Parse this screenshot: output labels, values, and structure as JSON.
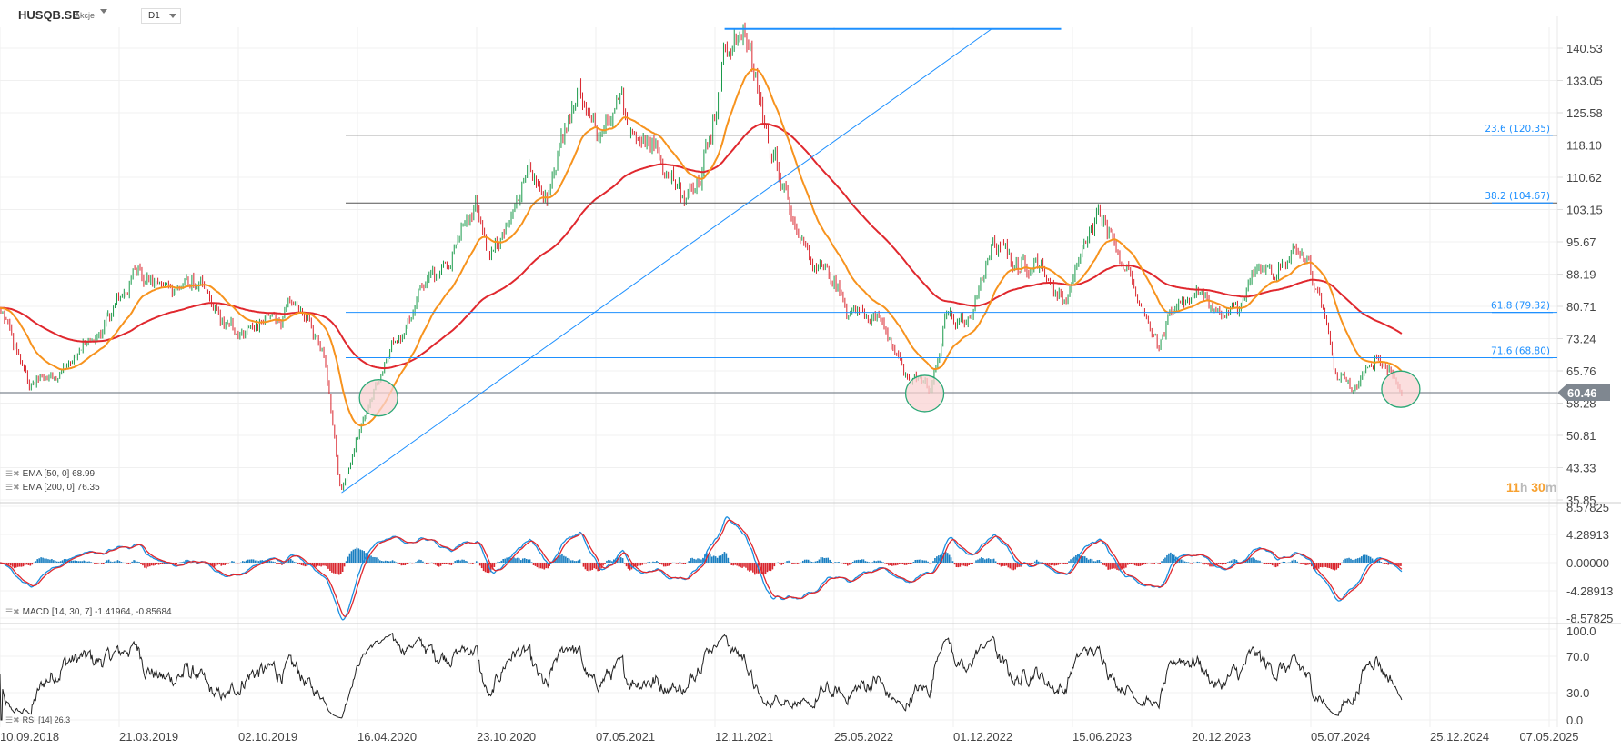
{
  "header": {
    "symbol": "HUSQB.SE",
    "type": "Akcje",
    "timeframe": "D1"
  },
  "legends": {
    "ema50": "EMA [50, 0] 68.99",
    "ema200": "EMA [200, 0] 76.35",
    "macd": "MACD [14, 30, 7] -1.41964, -0.85684",
    "rsi": "RSI [14] 26.3"
  },
  "timer": {
    "hours": "11",
    "h": "h",
    "minutes": "30",
    "m": "m"
  },
  "colors": {
    "up": "#1a9a4a",
    "down": "#d9262e",
    "ema50": "#f7931e",
    "ema200": "#e0282e",
    "fib": "#1e90ff",
    "macd_pos": "#1a7fc1",
    "macd_neg": "#d9262e",
    "circle_fill": "#f9d3d3",
    "circle_stroke": "#2aa876"
  },
  "chart_data": {
    "type": "candlestick",
    "title": "HUSQB.SE D1",
    "x_unit": "calendar days since 10.09.2018",
    "keypoints": [
      [
        0,
        80
      ],
      [
        49,
        62
      ],
      [
        114,
        68
      ],
      [
        162,
        75
      ],
      [
        219,
        90
      ],
      [
        260,
        85
      ],
      [
        309,
        86
      ],
      [
        357,
        75
      ],
      [
        422,
        77
      ],
      [
        471,
        80
      ],
      [
        512,
        70
      ],
      [
        536,
        38
      ],
      [
        560,
        50
      ],
      [
        585,
        60
      ],
      [
        617,
        70
      ],
      [
        666,
        85
      ],
      [
        715,
        95
      ],
      [
        747,
        105
      ],
      [
        771,
        90
      ],
      [
        796,
        100
      ],
      [
        828,
        110
      ],
      [
        861,
        103
      ],
      [
        893,
        125
      ],
      [
        909,
        130
      ],
      [
        934,
        120
      ],
      [
        974,
        125
      ],
      [
        1023,
        120
      ],
      [
        1080,
        105
      ],
      [
        1121,
        125
      ],
      [
        1137,
        140
      ],
      [
        1172,
        145
      ],
      [
        1202,
        120
      ],
      [
        1234,
        110
      ],
      [
        1267,
        90
      ],
      [
        1299,
        88
      ],
      [
        1332,
        80
      ],
      [
        1380,
        78
      ],
      [
        1421,
        65
      ],
      [
        1462,
        62
      ],
      [
        1486,
        80
      ],
      [
        1518,
        75
      ],
      [
        1559,
        95
      ],
      [
        1600,
        90
      ],
      [
        1624,
        92
      ],
      [
        1673,
        82
      ],
      [
        1705,
        95
      ],
      [
        1733,
        104
      ],
      [
        1754,
        95
      ],
      [
        1786,
        85
      ],
      [
        1819,
        70
      ],
      [
        1851,
        82
      ],
      [
        1884,
        85
      ],
      [
        1916,
        78
      ],
      [
        1949,
        80
      ],
      [
        1973,
        88
      ],
      [
        2014,
        90
      ],
      [
        2046,
        92
      ],
      [
        2071,
        85
      ],
      [
        2079,
        80
      ],
      [
        2095,
        66
      ],
      [
        2127,
        62
      ],
      [
        2160,
        70
      ],
      [
        2184,
        66
      ],
      [
        2200,
        60.46
      ]
    ],
    "last_price": "60.46",
    "price_ticks": [
      "140.53",
      "133.05",
      "125.58",
      "118.10",
      "110.62",
      "103.15",
      "95.67",
      "88.19",
      "80.71",
      "73.24",
      "65.76",
      "58.28",
      "50.81",
      "43.33",
      "35.85"
    ],
    "macd_ticks": [
      "8.57825",
      "4.28913",
      "0.00000",
      "-4.28913",
      "-8.57825"
    ],
    "rsi_ticks": [
      "100.0",
      "70.0",
      "30.0",
      "0.0"
    ],
    "date_ticks": [
      "10.09.2018",
      "21.03.2019",
      "02.10.2019",
      "16.04.2020",
      "23.10.2020",
      "07.05.2021",
      "12.11.2021",
      "25.05.2022",
      "01.12.2022",
      "15.06.2023",
      "20.12.2023",
      "05.07.2024",
      "25.12.2024",
      "07.05.2025"
    ],
    "fib_levels": [
      {
        "label": "23.6 (120.35)",
        "value": 120.35,
        "style": "dark"
      },
      {
        "label": "38.2 (104.67)",
        "value": 104.67,
        "style": "dark"
      },
      {
        "label": "61.8 (79.32)",
        "value": 79.32,
        "style": "blue"
      },
      {
        "label": "71.6 (68.80)",
        "value": 68.8,
        "style": "blue"
      }
    ],
    "trendline": {
      "from": [
        536,
        37.5
      ],
      "to": [
        1556,
        145
      ]
    },
    "top_line": {
      "from": [
        1137,
        145
      ],
      "to": [
        1665,
        145
      ]
    },
    "highlight_circles": [
      [
        594,
        59.5
      ],
      [
        1451,
        60.5
      ],
      [
        2198,
        61.5
      ]
    ],
    "indicators": {
      "ema_periods": [
        50,
        200
      ],
      "macd": [
        14,
        30,
        7
      ],
      "rsi": 14
    }
  }
}
